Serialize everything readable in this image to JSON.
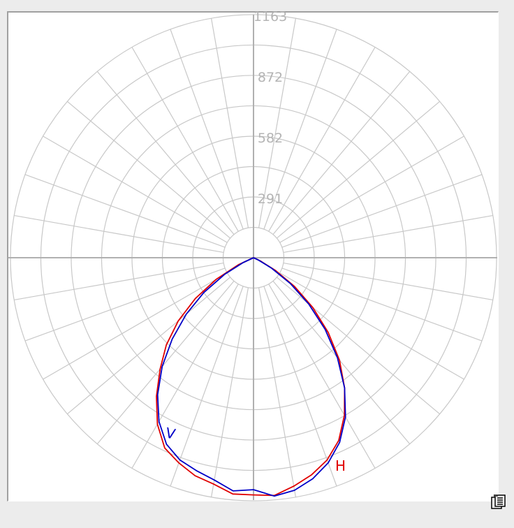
{
  "chart_data": {
    "type": "polar",
    "title": "",
    "radial_max": 1163,
    "ring_labels": [
      "291",
      "582",
      "872",
      "1163"
    ],
    "ring_values": [
      291,
      582,
      872,
      1163
    ],
    "minor_ring_step": 145.4,
    "spoke_step_deg": 10,
    "grid": true,
    "series": [
      {
        "name": "H",
        "color": "#e00000",
        "angles_deg": [
          0,
          5,
          10,
          15,
          20,
          25,
          30,
          35,
          40,
          45,
          50,
          55,
          60,
          65,
          70,
          75,
          80,
          85,
          90,
          95,
          100,
          105,
          110,
          115,
          120,
          125,
          130,
          135,
          140,
          145,
          150,
          155,
          160,
          165,
          170,
          175,
          180,
          185,
          190,
          195,
          200,
          205,
          210,
          215,
          220,
          225,
          230,
          235,
          240,
          245,
          250,
          255,
          260,
          265,
          270,
          275,
          280,
          285,
          290,
          295,
          300,
          305,
          310,
          315,
          320,
          325,
          330,
          335,
          340,
          345,
          350,
          355,
          360
        ],
        "values": [
          1135,
          1142,
          1110,
          1075,
          1030,
          965,
          870,
          760,
          640,
          505,
          370,
          240,
          120,
          35,
          0,
          0,
          0,
          0,
          0,
          0,
          0,
          0,
          0,
          0,
          0,
          0,
          0,
          0,
          0,
          0,
          0,
          0,
          0,
          0,
          0,
          0,
          0,
          0,
          0,
          0,
          0,
          0,
          0,
          0,
          0,
          0,
          0,
          0,
          0,
          0,
          0,
          0,
          0,
          0,
          0,
          0,
          0,
          0,
          0,
          0,
          0,
          0,
          0,
          0,
          0,
          0,
          0,
          0,
          0,
          0,
          0,
          0,
          0
        ],
        "values_left": [
          1135,
          1135,
          1100,
          1080,
          1045,
          1005,
          920,
          810,
          695,
          590,
          470,
          340,
          205,
          80,
          0
        ]
      },
      {
        "name": "V",
        "color": "#0000c8",
        "angles_deg": [
          0,
          5,
          10,
          15,
          20,
          25,
          30,
          35,
          40,
          45,
          50,
          55,
          60,
          65,
          70
        ],
        "values": [
          1110,
          1145,
          1130,
          1095,
          1045,
          975,
          880,
          760,
          625,
          485,
          345,
          215,
          100,
          25,
          0
        ],
        "values_left": [
          1110,
          1120,
          1080,
          1055,
          1030,
          985,
          905,
          800,
          680,
          550,
          420,
          290,
          160,
          55,
          0
        ]
      }
    ]
  },
  "toolbar": {
    "copy_icon": "copy-to-clipboard-icon"
  }
}
